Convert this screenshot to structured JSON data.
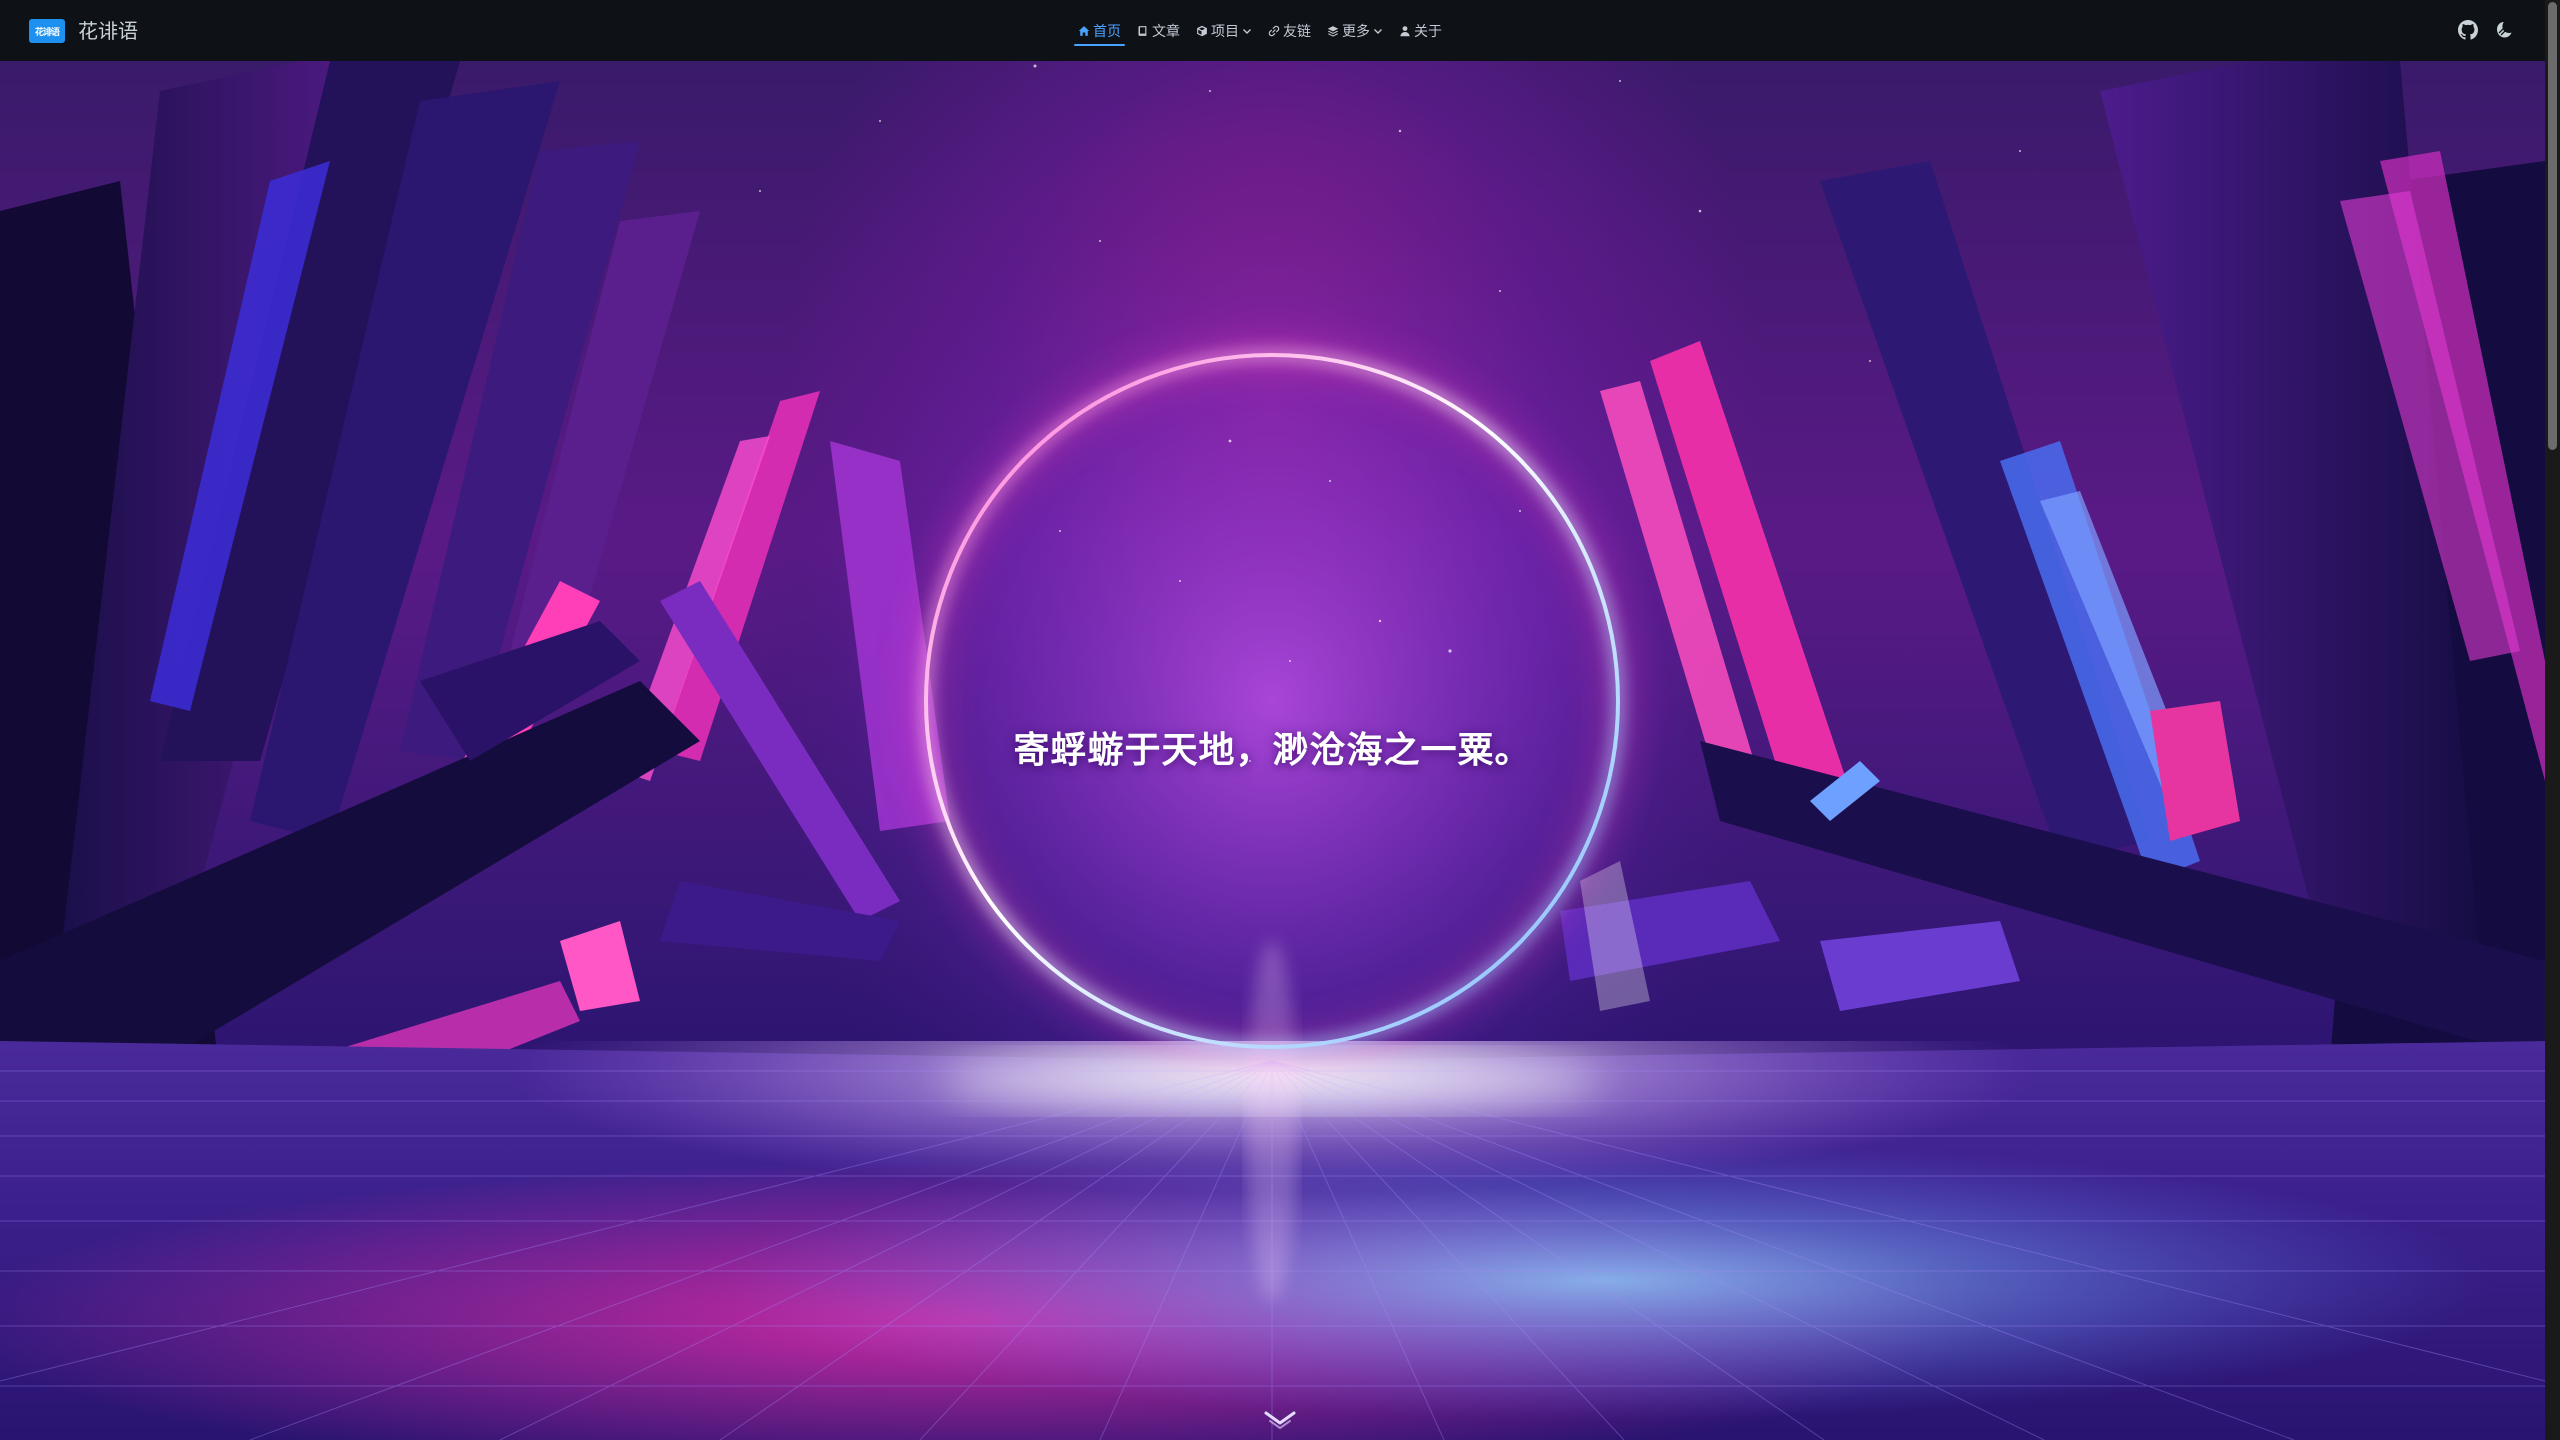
{
  "brand": {
    "logo_text": "花诽语",
    "name": "花诽语"
  },
  "nav": {
    "items": [
      {
        "label": "首页",
        "icon": "home-icon",
        "active": true,
        "dropdown": false
      },
      {
        "label": "文章",
        "icon": "book-icon",
        "active": false,
        "dropdown": false
      },
      {
        "label": "项目",
        "icon": "box-icon",
        "active": false,
        "dropdown": true
      },
      {
        "label": "友链",
        "icon": "link-icon",
        "active": false,
        "dropdown": false
      },
      {
        "label": "更多",
        "icon": "layers-icon",
        "active": false,
        "dropdown": true
      },
      {
        "label": "关于",
        "icon": "user-icon",
        "active": false,
        "dropdown": false
      }
    ],
    "right_icons": [
      "github-icon",
      "theme-toggle-icon"
    ]
  },
  "hero": {
    "title": "寄蜉蝣于天地，渺沧海之一粟。",
    "scroll_icon": "chevron-down-icon"
  },
  "colors": {
    "navbar_bg": "#0e1116",
    "accent": "#4aa3ff",
    "brand_logo_bg": "#1e90f0"
  }
}
